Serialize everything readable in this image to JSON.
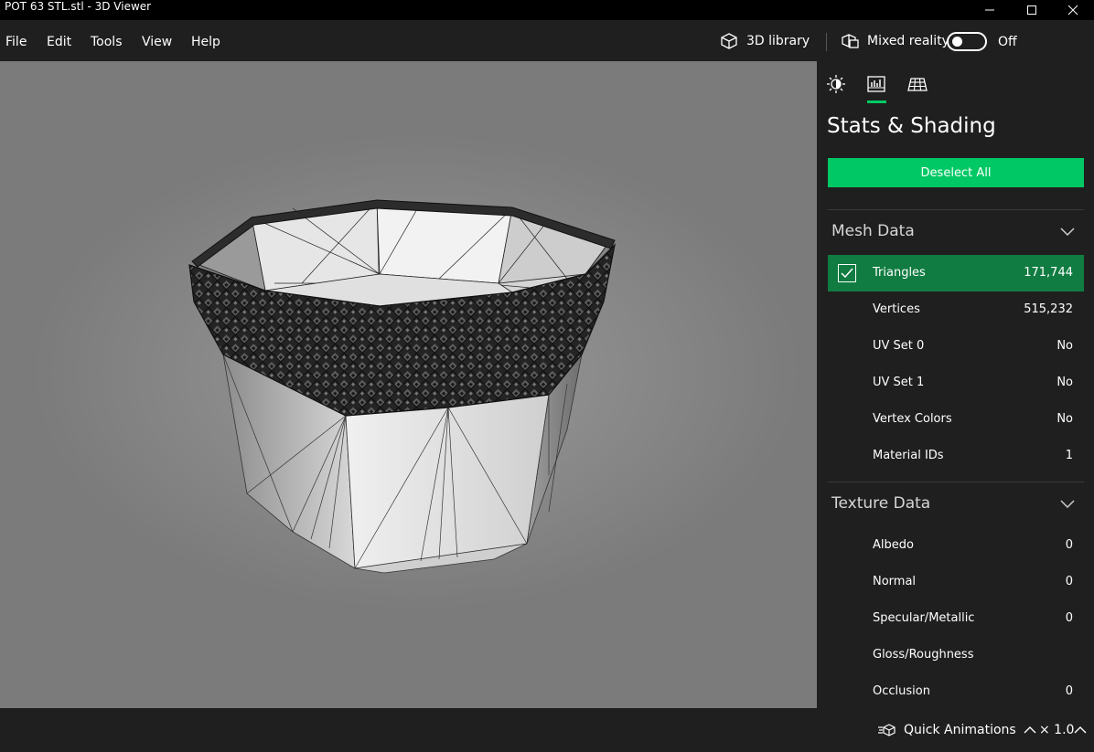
{
  "window": {
    "title": "POT 63 STL.stl - 3D Viewer"
  },
  "menu": {
    "items": [
      "File",
      "Edit",
      "Tools",
      "View",
      "Help"
    ]
  },
  "toolbar": {
    "library_label": "3D library",
    "mixed_reality_label": "Mixed reality",
    "mixed_reality_state": "Off",
    "mixed_reality_on": false
  },
  "panel": {
    "tabs": [
      "lighting-icon",
      "stats-icon",
      "grid-icon"
    ],
    "active_tab": 1,
    "title": "Stats & Shading",
    "deselect_label": "Deselect All",
    "mesh_header": "Mesh Data",
    "mesh_rows": [
      {
        "label": "Triangles",
        "value": "171,744",
        "checked": true
      },
      {
        "label": "Vertices",
        "value": "515,232"
      },
      {
        "label": "UV Set 0",
        "value": "No"
      },
      {
        "label": "UV Set 1",
        "value": "No"
      },
      {
        "label": "Vertex Colors",
        "value": "No"
      },
      {
        "label": "Material IDs",
        "value": "1"
      }
    ],
    "texture_header": "Texture Data",
    "texture_rows": [
      {
        "label": "Albedo",
        "value": "0"
      },
      {
        "label": "Normal",
        "value": "0"
      },
      {
        "label": "Specular/Metallic",
        "value": "0"
      },
      {
        "label": "Gloss/Roughness",
        "value": ""
      },
      {
        "label": "Occlusion",
        "value": "0"
      }
    ]
  },
  "status": {
    "quick_animations_label": "Quick Animations",
    "zoom_label": "× 1.0"
  },
  "colors": {
    "accent": "#00c864",
    "selected_row": "#107c41",
    "panel_bg": "#1f1f1f"
  }
}
